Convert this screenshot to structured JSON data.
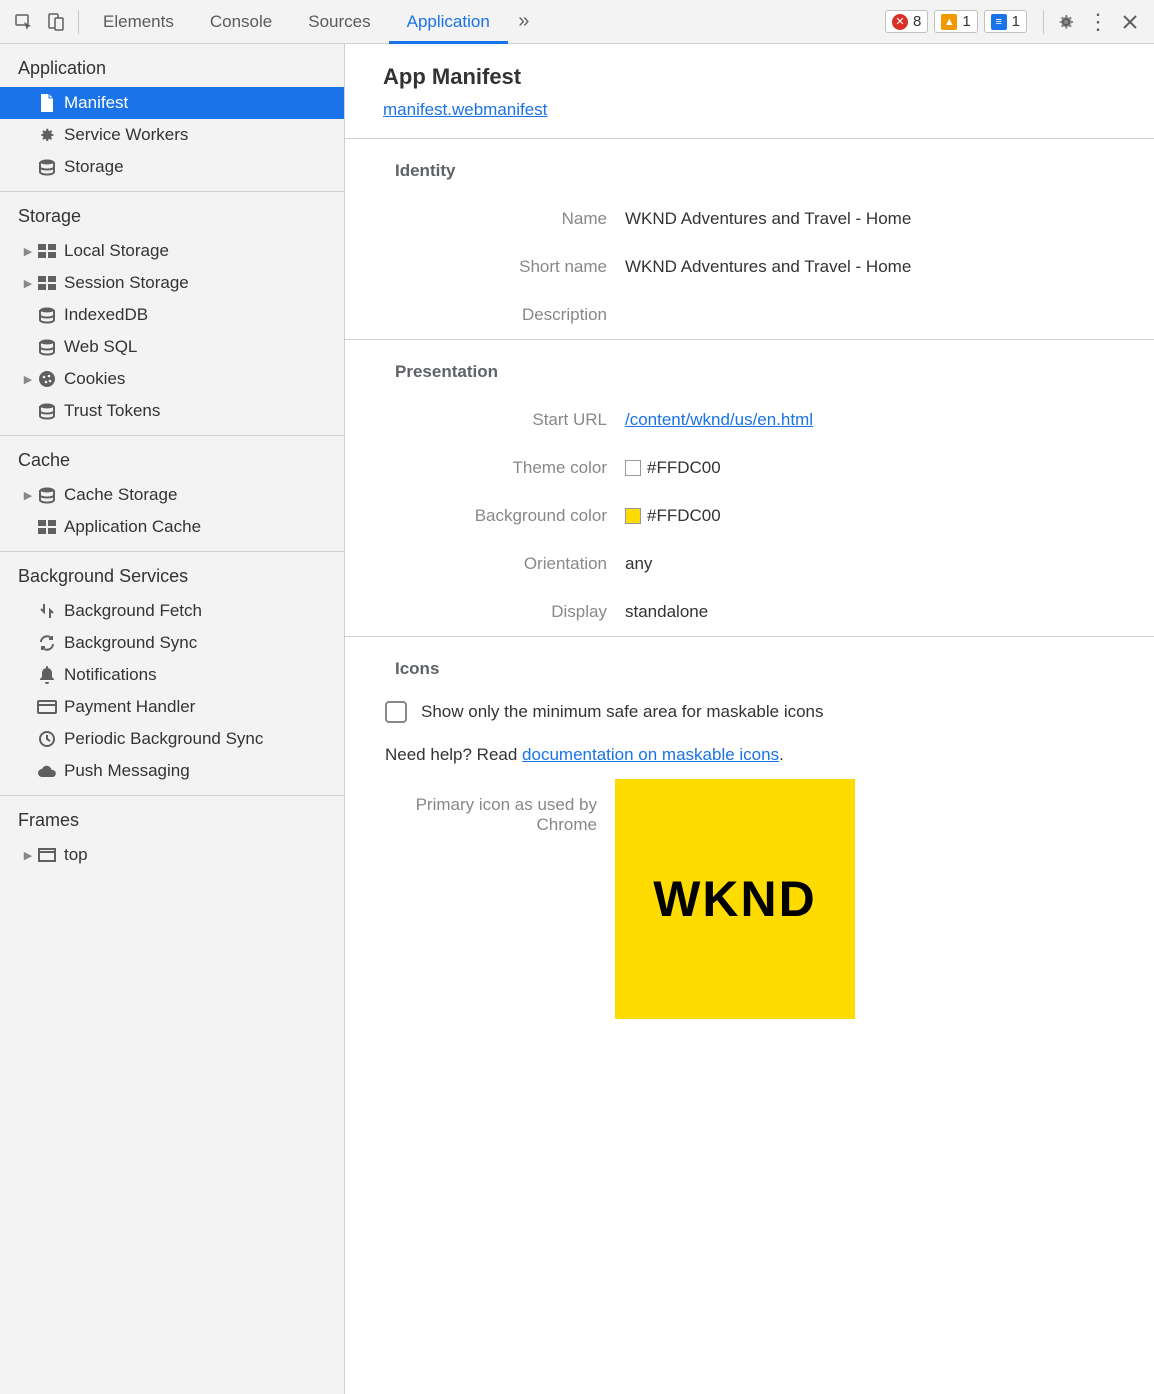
{
  "tabs": {
    "elements": "Elements",
    "console": "Console",
    "sources": "Sources",
    "application": "Application"
  },
  "toolbar_badges": {
    "errors": "8",
    "warnings": "1",
    "issues": "1"
  },
  "sidebar": {
    "section_application": "Application",
    "items_app": {
      "manifest": "Manifest",
      "service_workers": "Service Workers",
      "storage": "Storage"
    },
    "section_storage": "Storage",
    "items_storage": {
      "local_storage": "Local Storage",
      "session_storage": "Session Storage",
      "indexeddb": "IndexedDB",
      "websql": "Web SQL",
      "cookies": "Cookies",
      "trust_tokens": "Trust Tokens"
    },
    "section_cache": "Cache",
    "items_cache": {
      "cache_storage": "Cache Storage",
      "application_cache": "Application Cache"
    },
    "section_bg": "Background Services",
    "items_bg": {
      "bg_fetch": "Background Fetch",
      "bg_sync": "Background Sync",
      "notifications": "Notifications",
      "payment": "Payment Handler",
      "periodic": "Periodic Background Sync",
      "push": "Push Messaging"
    },
    "section_frames": "Frames",
    "items_frames": {
      "top": "top"
    }
  },
  "content": {
    "title": "App Manifest",
    "manifest_link": "manifest.webmanifest",
    "section_identity": "Identity",
    "identity": {
      "name_label": "Name",
      "name": "WKND Adventures and Travel - Home",
      "short_name_label": "Short name",
      "short_name": "WKND Adventures and Travel - Home",
      "description_label": "Description",
      "description": ""
    },
    "section_presentation": "Presentation",
    "presentation": {
      "start_url_label": "Start URL",
      "start_url": "/content/wknd/us/en.html",
      "theme_color_label": "Theme color",
      "theme_color": "#FFDC00",
      "bg_color_label": "Background color",
      "bg_color": "#FFDC00",
      "orientation_label": "Orientation",
      "orientation": "any",
      "display_label": "Display",
      "display": "standalone"
    },
    "section_icons": "Icons",
    "icons": {
      "maskable_checkbox": "Show only the minimum safe area for maskable icons",
      "help_prefix": "Need help? Read ",
      "help_link": "documentation on maskable icons",
      "help_suffix": ".",
      "primary_label_line1": "Primary icon as used by",
      "primary_label_line2": "Chrome",
      "icon_text": "WKND"
    }
  }
}
